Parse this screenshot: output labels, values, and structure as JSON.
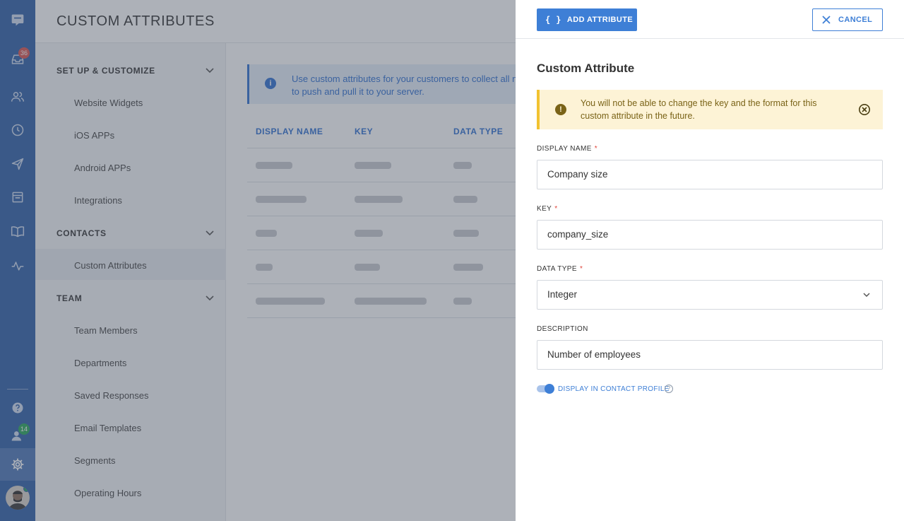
{
  "page": {
    "title": "CUSTOM ATTRIBUTES"
  },
  "rail": {
    "inbox_badge": "36",
    "contacts_badge": "14",
    "colors": {
      "rail": "#2f5fa8",
      "inbox_badge": "#d9534f",
      "contacts_badge": "#27a65a"
    }
  },
  "settings_nav": {
    "groups": [
      {
        "label": "SET UP & CUSTOMIZE",
        "items": [
          "Website Widgets",
          "iOS APPs",
          "Android APPs",
          "Integrations"
        ]
      },
      {
        "label": "CONTACTS",
        "items": [
          "Custom Attributes"
        ]
      },
      {
        "label": "TEAM",
        "items": [
          "Team Members",
          "Departments",
          "Saved Responses",
          "Email Templates",
          "Segments",
          "Operating Hours"
        ]
      }
    ],
    "active_item": "Custom Attributes"
  },
  "main": {
    "info_text": "Use custom attributes for your customers to collect all ne",
    "info_text_2": "to push and pull it to your server.",
    "table": {
      "columns": [
        "DISPLAY NAME",
        "KEY",
        "DATA TYPE"
      ]
    }
  },
  "panel": {
    "add_button": "ADD ATTRIBUTE",
    "add_button_icon": "{ }",
    "cancel_button": "CANCEL",
    "title": "Custom Attribute",
    "warning_line1": "You will not be able to change the key and the format for this",
    "warning_line2": "custom attribute in the future.",
    "fields": {
      "display_name": {
        "label": "DISPLAY NAME",
        "value": "Company size",
        "required": "*"
      },
      "key": {
        "label": "KEY",
        "value": "company_size",
        "required": "*"
      },
      "data_type": {
        "label": "DATA TYPE",
        "value": "Integer",
        "required": "*"
      },
      "description": {
        "label": "DESCRIPTION",
        "value": "Number of employees"
      }
    },
    "toggle_label": "DISPLAY IN CONTACT PROFILE",
    "toggle_on": true,
    "help_glyph": "?"
  }
}
